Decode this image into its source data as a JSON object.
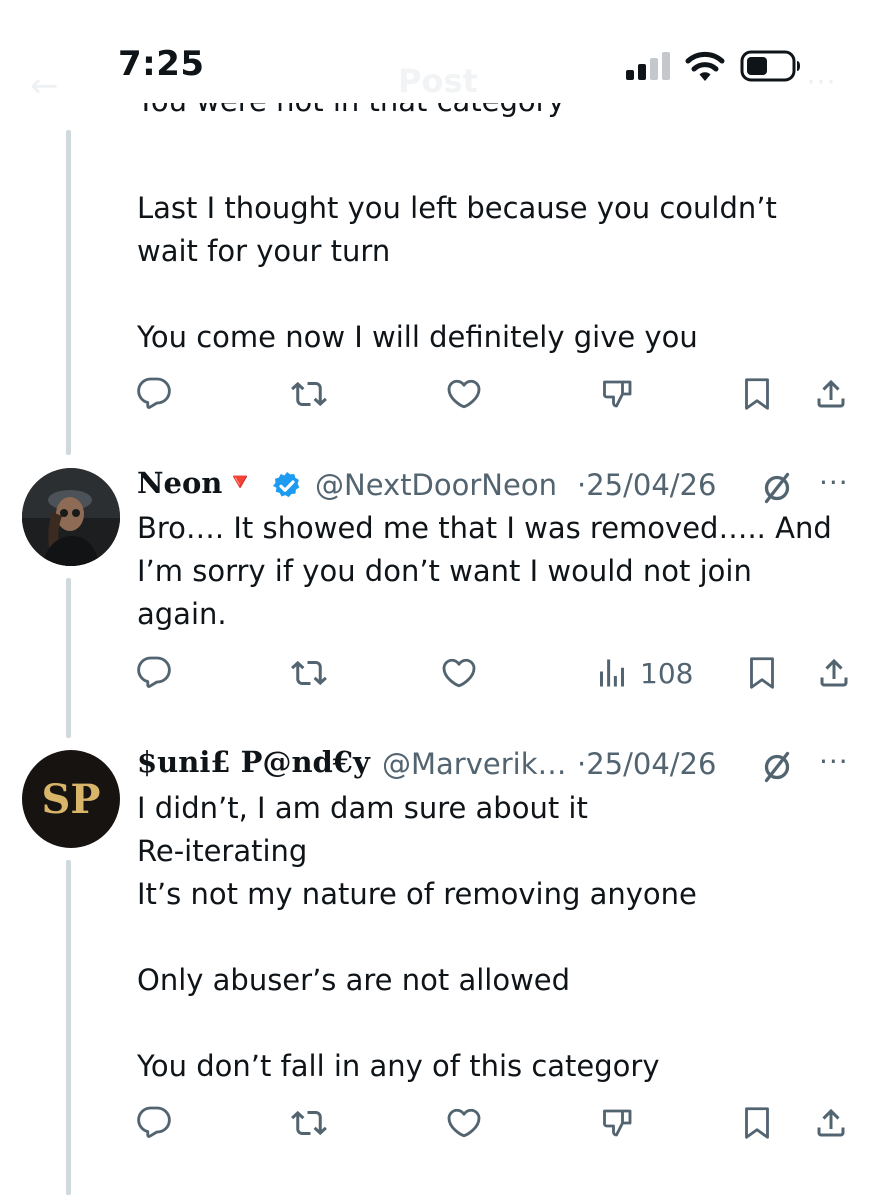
{
  "status_bar": {
    "time": "7:25",
    "ghost_title": "Post",
    "icons": [
      "signal-icon",
      "wifi-icon",
      "battery-icon"
    ]
  },
  "colors": {
    "text": "#0f1419",
    "secondary": "#536471",
    "thread_line": "#cfd9de",
    "verified": "#1d9bf0",
    "neon_flag": "#f4212e"
  },
  "posts": [
    {
      "cut_text": "You were not in that category",
      "lines": [
        "Last I thought you left because you couldn’t",
        "wait for your turn",
        "",
        "You come now I will definitely give you"
      ],
      "actions": [
        "reply-icon",
        "repost-icon",
        "like-icon",
        "dislike-icon",
        "bookmark-icon",
        "share-icon"
      ]
    },
    {
      "display_name": "Neon",
      "emoji_flag": "🔻",
      "verified": true,
      "handle": "@NextDoorNeon",
      "date": "·25/04/26",
      "lines": [
        "Bro…. It showed me that I was removed….. And",
        "I’m sorry if you don’t want I would not join",
        "again."
      ],
      "views": "108",
      "actions": [
        "reply-icon",
        "repost-icon",
        "like-icon",
        "views-icon",
        "bookmark-icon",
        "share-icon"
      ]
    },
    {
      "avatar_initials": "SP",
      "display_name": "$uni£ P@nd€y",
      "handle": "@Marverik…",
      "date": "·25/04/26",
      "lines": [
        "I didn’t, I am dam sure about it",
        "Re-iterating",
        "It’s not my nature of removing anyone",
        "",
        "Only abuser’s are not allowed",
        "",
        "You don’t fall in any of this category"
      ],
      "actions": [
        "reply-icon",
        "repost-icon",
        "like-icon",
        "dislike-icon",
        "bookmark-icon",
        "share-icon"
      ]
    }
  ]
}
